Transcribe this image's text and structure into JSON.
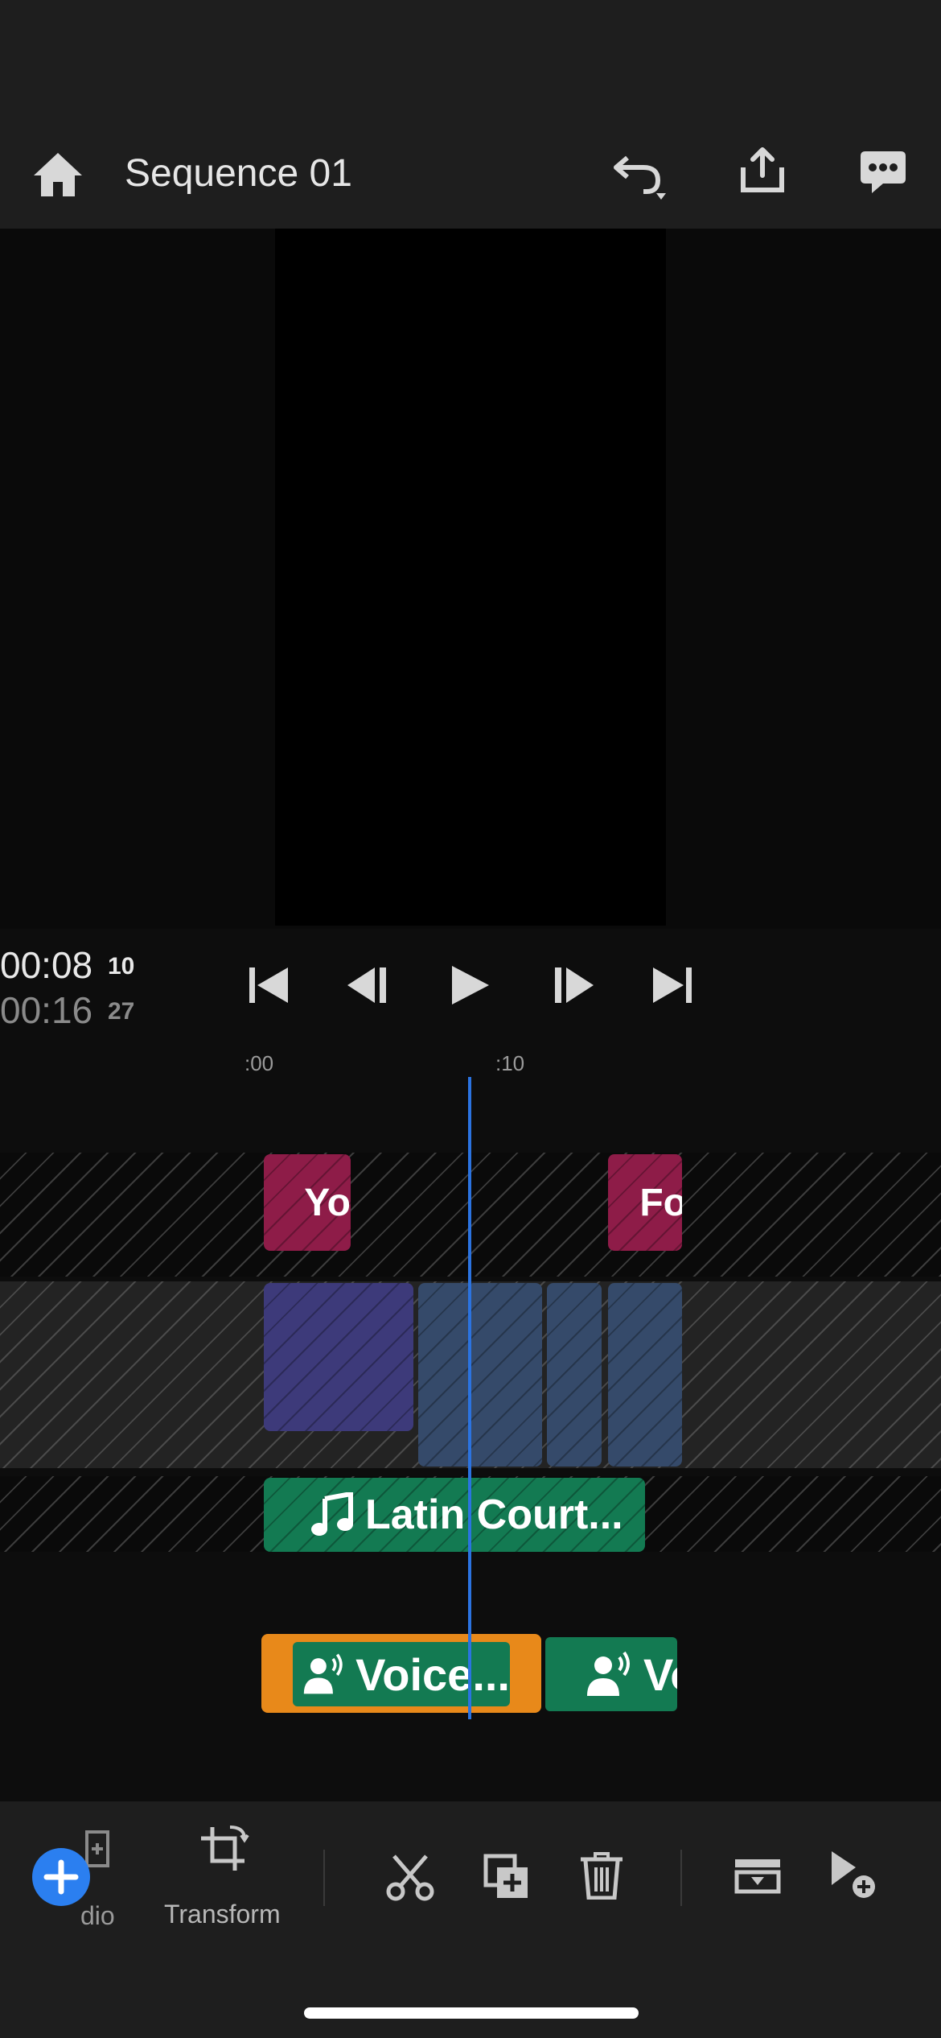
{
  "header": {
    "title": "Sequence 01",
    "icons": [
      "home-icon",
      "undo-icon",
      "share-icon",
      "feedback-icon"
    ]
  },
  "playback": {
    "current_time": "00:08",
    "current_frames": "10",
    "total_time": "00:16",
    "total_frames": "27",
    "controls": [
      "skip-to-start-icon",
      "step-back-icon",
      "play-icon",
      "step-forward-icon",
      "skip-to-end-icon"
    ]
  },
  "timeline": {
    "ruler_marks": [
      ":00",
      ":10"
    ],
    "title_clips": [
      "Yo",
      "Fo"
    ],
    "music_clip": "Latin Court...",
    "voice_clips": [
      "Voice...",
      "Vo"
    ]
  },
  "toolbar": {
    "partial_label": "dio",
    "transform_label": "Transform",
    "icons": [
      "add-icon",
      "transform-icon",
      "scissors-icon",
      "duplicate-icon",
      "trash-icon",
      "replace-icon",
      "insert-icon"
    ]
  },
  "colors": {
    "accent": "#2b73e0",
    "title_clip": "#8e1c48",
    "audio_clip": "#137a52",
    "selected_clip": "#e8891a",
    "video_clip_a": "#3d3a7a",
    "video_clip_b": "#354a6a"
  }
}
